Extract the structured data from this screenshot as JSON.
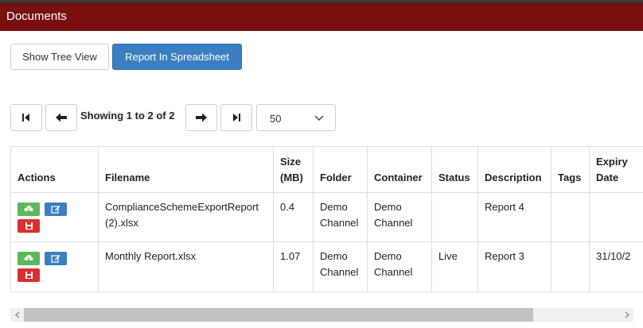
{
  "window": {
    "title": "Documents"
  },
  "toolbar": {
    "tree_view_label": "Show Tree View",
    "report_label": "Report In Spreadsheet"
  },
  "pager": {
    "showing": "Showing 1 to 2 of 2",
    "page_size": "50"
  },
  "table": {
    "headers": {
      "actions": "Actions",
      "filename": "Filename",
      "size_line1": "Size",
      "size_line2": "(MB)",
      "folder": "Folder",
      "container": "Container",
      "status": "Status",
      "description": "Description",
      "tags": "Tags",
      "expiry_line1": "Expiry",
      "expiry_line2": "Date"
    },
    "rows": [
      {
        "filename_line1": "ComplianceSchemeExportReport",
        "filename_line2": "(2).xlsx",
        "size": "0.4",
        "folder_line1": "Demo",
        "folder_line2": "Channel",
        "container_line1": "Demo",
        "container_line2": "Channel",
        "status": "",
        "description": "Report 4",
        "tags": "",
        "expiry": ""
      },
      {
        "filename_line1": "Monthly Report.xlsx",
        "filename_line2": "",
        "size": "1.07",
        "folder_line1": "Demo",
        "folder_line2": "Channel",
        "container_line1": "Demo",
        "container_line2": "Channel",
        "status": "Live",
        "description": "Report 3",
        "tags": "",
        "expiry": "31/10/2"
      }
    ]
  },
  "colors": {
    "titlebar": "#7a0e0e",
    "primary": "#3a7fc1",
    "success": "#5cb85c",
    "danger": "#d9302f"
  }
}
